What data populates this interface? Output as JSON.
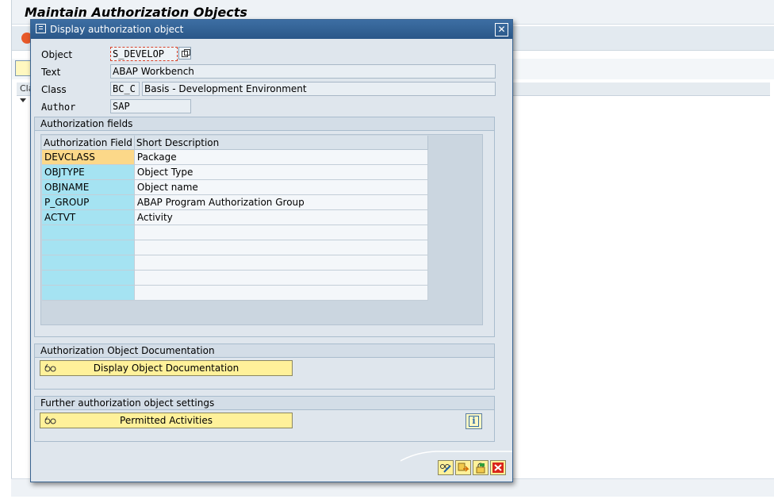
{
  "app": {
    "title": "Maintain Authorization Objects",
    "tree_header": "Cla"
  },
  "dialog": {
    "title": "Display authorization object",
    "header": {
      "object_label": "Object",
      "object_value": "S_DEVELOP",
      "text_label": "Text",
      "text_value": "ABAP Workbench",
      "class_label": "Class",
      "class_code": "BC_C",
      "class_text": "Basis - Development Environment",
      "author_label": "Author",
      "author_value": "SAP"
    },
    "fields_group": {
      "title": "Authorization fields",
      "columns": [
        "Authorization Field",
        "Short Description"
      ],
      "rows": [
        {
          "field": "DEVCLASS",
          "description": "Package"
        },
        {
          "field": "OBJTYPE",
          "description": "Object Type"
        },
        {
          "field": "OBJNAME",
          "description": "Object name"
        },
        {
          "field": "P_GROUP",
          "description": "ABAP Program Authorization Group"
        },
        {
          "field": "ACTVT",
          "description": "Activity"
        },
        {
          "field": "",
          "description": ""
        },
        {
          "field": "",
          "description": ""
        },
        {
          "field": "",
          "description": ""
        },
        {
          "field": "",
          "description": ""
        },
        {
          "field": "",
          "description": ""
        }
      ]
    },
    "documentation_group": {
      "title": "Authorization Object Documentation",
      "button_label": "Display Object Documentation"
    },
    "settings_group": {
      "title": "Further authorization object settings",
      "button_label": "Permitted Activities",
      "info_icon": "i"
    },
    "footer_buttons": [
      "glasses-edit-icon",
      "transfer-icon",
      "lock-icon",
      "cancel-icon"
    ],
    "colors": {
      "title_bar": "#2a5788",
      "key_column": "#a5e3f2",
      "selected_key": "#fcd889",
      "button": "#fff19a",
      "cancel": "#d9261c"
    }
  }
}
